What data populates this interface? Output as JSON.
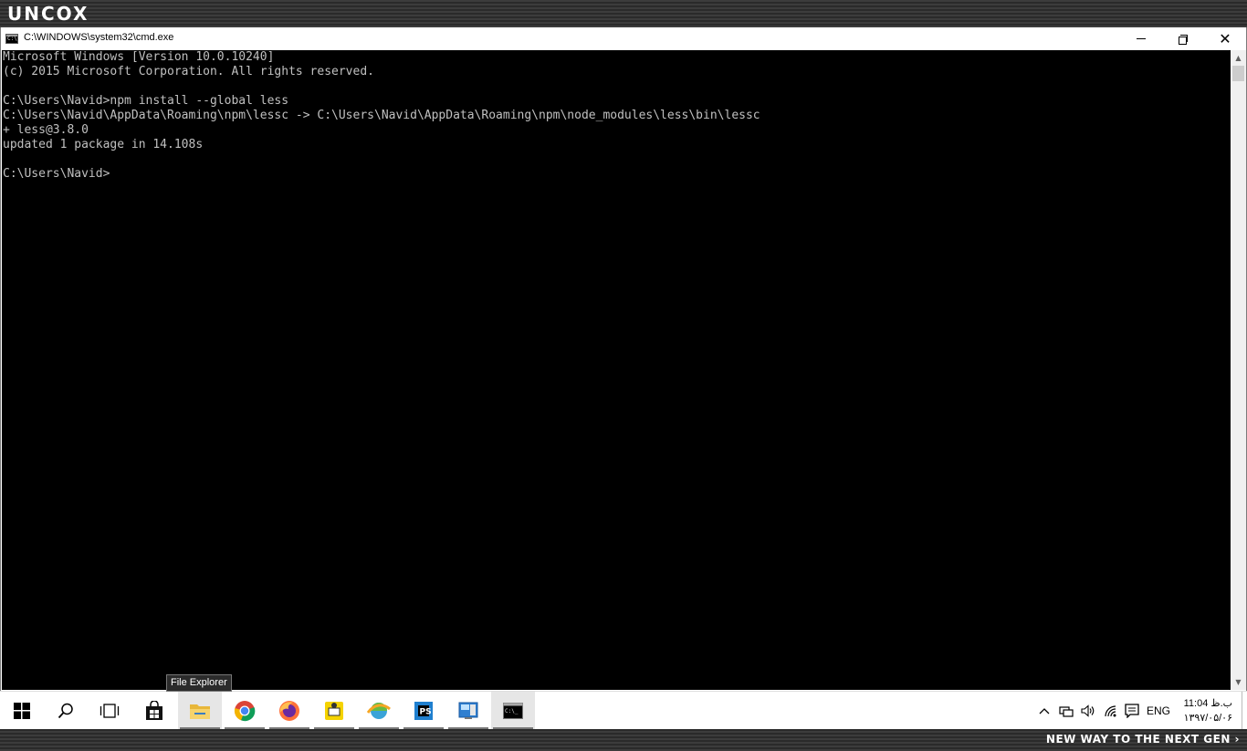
{
  "branding": {
    "logo": "UNCOX",
    "tagline": "NEW WAY TO THE NEXT GEN ›"
  },
  "window": {
    "title": "C:\\WINDOWS\\system32\\cmd.exe",
    "minimize_label": "Minimize",
    "restore_label": "Restore Down",
    "close_label": "Close"
  },
  "console": {
    "lines": [
      "Microsoft Windows [Version 10.0.10240]",
      "(c) 2015 Microsoft Corporation. All rights reserved.",
      "",
      "C:\\Users\\Navid>npm install --global less",
      "C:\\Users\\Navid\\AppData\\Roaming\\npm\\lessc -> C:\\Users\\Navid\\AppData\\Roaming\\npm\\node_modules\\less\\bin\\lessc",
      "+ less@3.8.0",
      "updated 1 package in 14.108s",
      "",
      "C:\\Users\\Navid>"
    ],
    "text_color": "#c0c0c0",
    "background": "#000000"
  },
  "tooltip": {
    "text": "File Explorer"
  },
  "taskbar": {
    "items": [
      {
        "name": "Start",
        "icon": "windows-logo-icon"
      },
      {
        "name": "Search",
        "icon": "search-icon"
      },
      {
        "name": "Task View",
        "icon": "task-view-icon"
      },
      {
        "name": "Store",
        "icon": "store-icon"
      },
      {
        "name": "File Explorer",
        "icon": "folder-icon"
      },
      {
        "name": "Google Chrome",
        "icon": "chrome-icon"
      },
      {
        "name": "Firefox",
        "icon": "firefox-icon"
      },
      {
        "name": "PHP app",
        "icon": "php-icon"
      },
      {
        "name": "Internet Download Manager",
        "icon": "idm-icon"
      },
      {
        "name": "JetBrains IDE",
        "icon": "jetbrains-icon"
      },
      {
        "name": "Control Panel",
        "icon": "control-panel-icon"
      },
      {
        "name": "Command Prompt",
        "icon": "cmd-icon"
      }
    ],
    "tray": {
      "language": "ENG",
      "time": "11:04 ب.ظ",
      "date": "۱۳۹۷/۰۵/۰۶"
    }
  },
  "colors": {
    "accent_yellow": "#f5d300",
    "firefox_orange": "#ff7139",
    "jetbrains_blue": "#1f7fcf"
  }
}
